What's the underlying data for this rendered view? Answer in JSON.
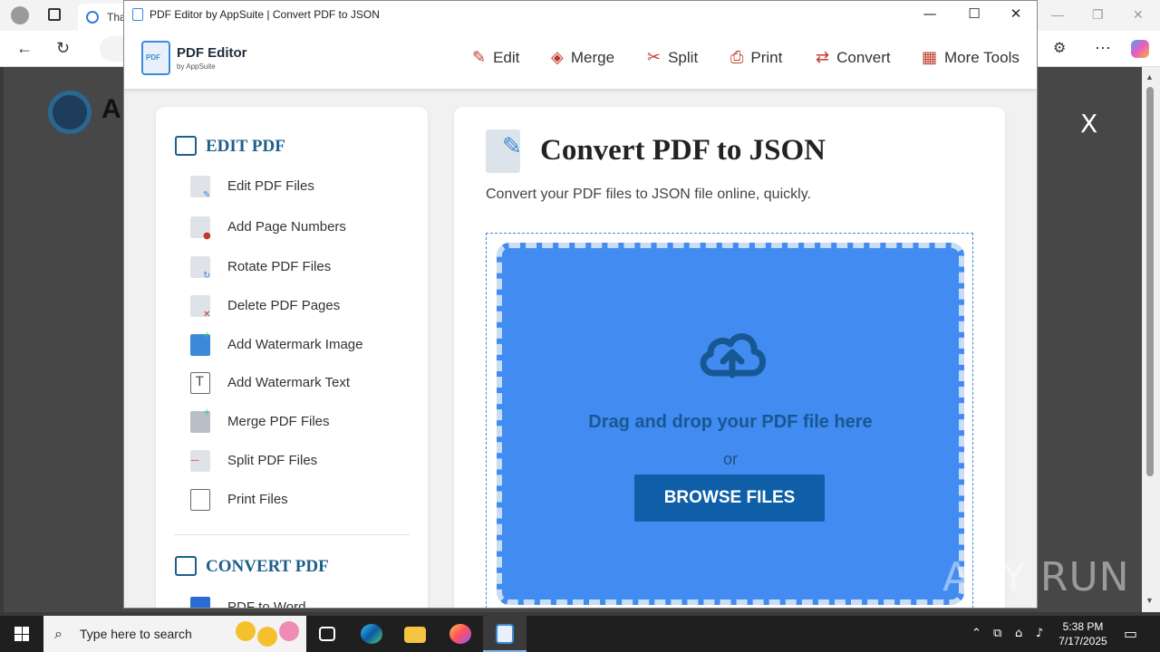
{
  "window": {
    "title": "PDF Editor by AppSuite | Convert PDF to JSON",
    "minimize_glyph": "—",
    "maximize_glyph": "☐",
    "close_glyph": "✕"
  },
  "background_browser": {
    "tab_title": "Tha",
    "page_logo_letter": "A",
    "overlay_close": "X"
  },
  "brand": {
    "icon_label": "PDF",
    "name": "PDF Editor",
    "sub": "by AppSuite"
  },
  "topnav": [
    {
      "label": "Edit",
      "icon": "pencil-icon",
      "glyph": "✎"
    },
    {
      "label": "Merge",
      "icon": "layers-icon",
      "glyph": "◈"
    },
    {
      "label": "Split",
      "icon": "scissors-icon",
      "glyph": "✂"
    },
    {
      "label": "Print",
      "icon": "printer-icon",
      "glyph": "⎙"
    },
    {
      "label": "Convert",
      "icon": "convert-icon",
      "glyph": "⇄"
    },
    {
      "label": "More Tools",
      "icon": "grid-icon",
      "glyph": "▦"
    }
  ],
  "sidebar": {
    "edit_section": {
      "title": "EDIT PDF",
      "items": [
        {
          "label": "Edit PDF Files",
          "icon": "edit-file-icon"
        },
        {
          "label": "Add Page Numbers",
          "icon": "page-numbers-icon"
        },
        {
          "label": "Rotate PDF Files",
          "icon": "rotate-file-icon"
        },
        {
          "label": "Delete PDF Pages",
          "icon": "delete-page-icon"
        },
        {
          "label": "Add Watermark Image",
          "icon": "watermark-image-icon"
        },
        {
          "label": "Add Watermark Text",
          "icon": "watermark-text-icon"
        },
        {
          "label": "Merge PDF Files",
          "icon": "merge-files-icon"
        },
        {
          "label": "Split PDF Files",
          "icon": "split-files-icon"
        },
        {
          "label": "Print Files",
          "icon": "print-files-icon"
        }
      ]
    },
    "convert_section": {
      "title": "CONVERT PDF",
      "items": [
        {
          "label": "PDF to Word",
          "icon": "word-file-icon"
        }
      ]
    }
  },
  "main": {
    "title": "Convert PDF to JSON",
    "subtitle": "Convert your PDF files to JSON file online, quickly.",
    "dropzone": {
      "prompt": "Drag and drop your PDF file here",
      "or": "or",
      "button": "BROWSE FILES"
    }
  },
  "taskbar": {
    "search_placeholder": "Type here to search",
    "time": "5:38 PM",
    "date": "7/17/2025"
  },
  "watermark": "ANY RUN",
  "colors": {
    "accent": "#1d5f8a",
    "dropzone": "#428bf0",
    "button": "#0f5fa8",
    "nav_icon": "#c0392b"
  }
}
